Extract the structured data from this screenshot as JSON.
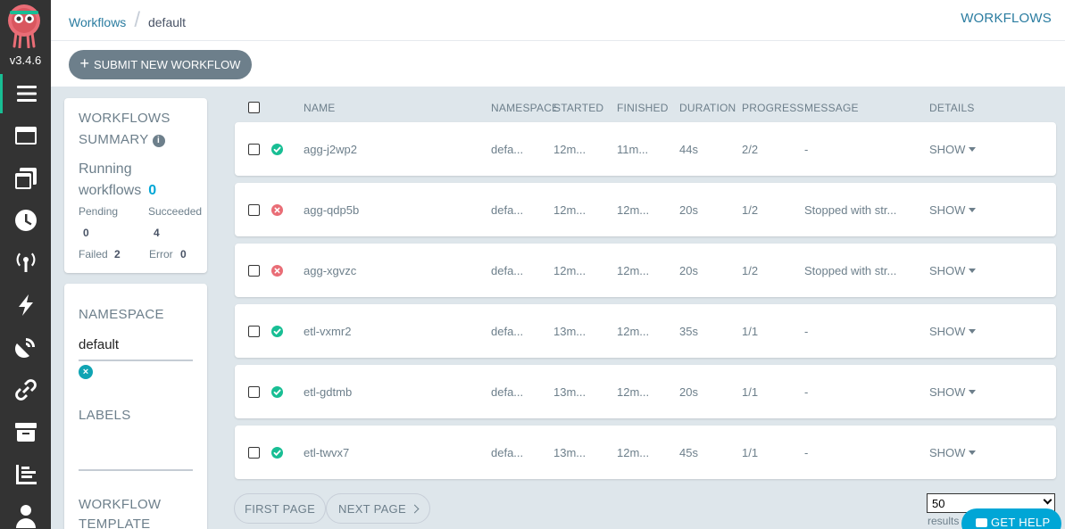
{
  "app": {
    "version": "v3.4.6"
  },
  "breadcrumb": {
    "root": "Workflows",
    "current": "default"
  },
  "page_title": "WORKFLOWS",
  "actions": {
    "submit_label": "SUBMIT NEW WORKFLOW"
  },
  "summary": {
    "title_line1": "WORKFLOWS",
    "title_line2": "SUMMARY",
    "running_line1": "Running",
    "running_line2": "workflows",
    "running_count": "0",
    "pending_label": "Pending",
    "pending_count": "0",
    "succeeded_label": "Succeeded",
    "succeeded_count": "4",
    "failed_label": "Failed",
    "failed_count": "2",
    "error_label": "Error",
    "error_count": "0"
  },
  "filters": {
    "namespace_label": "NAMESPACE",
    "namespace_value": "default",
    "labels_label": "LABELS",
    "workflow_template_label_line1": "WORKFLOW",
    "workflow_template_label_line2": "TEMPLATE"
  },
  "table": {
    "headers": {
      "name": "NAME",
      "namespace": "NAMESPACE",
      "started": "STARTED",
      "finished": "FINISHED",
      "duration": "DURATION",
      "progress": "PROGRESS",
      "message": "MESSAGE",
      "details": "DETAILS"
    },
    "rows": [
      {
        "status": "succeeded",
        "name": "agg-j2wp2",
        "namespace": "defa...",
        "started": "12m...",
        "finished": "11m...",
        "duration": "44s",
        "progress": "2/2",
        "message": "-",
        "details": "SHOW"
      },
      {
        "status": "failed",
        "name": "agg-qdp5b",
        "namespace": "defa...",
        "started": "12m...",
        "finished": "12m...",
        "duration": "20s",
        "progress": "1/2",
        "message": "Stopped with str...",
        "details": "SHOW"
      },
      {
        "status": "failed",
        "name": "agg-xgvzc",
        "namespace": "defa...",
        "started": "12m...",
        "finished": "12m...",
        "duration": "20s",
        "progress": "1/2",
        "message": "Stopped with str...",
        "details": "SHOW"
      },
      {
        "status": "succeeded",
        "name": "etl-vxmr2",
        "namespace": "defa...",
        "started": "13m...",
        "finished": "12m...",
        "duration": "35s",
        "progress": "1/1",
        "message": "-",
        "details": "SHOW"
      },
      {
        "status": "succeeded",
        "name": "etl-gdtmb",
        "namespace": "defa...",
        "started": "13m...",
        "finished": "12m...",
        "duration": "20s",
        "progress": "1/1",
        "message": "-",
        "details": "SHOW"
      },
      {
        "status": "succeeded",
        "name": "etl-twvx7",
        "namespace": "defa...",
        "started": "13m...",
        "finished": "12m...",
        "duration": "45s",
        "progress": "1/1",
        "message": "-",
        "details": "SHOW"
      }
    ]
  },
  "pagination": {
    "first_label": "FIRST PAGE",
    "next_label": "NEXT PAGE",
    "page_size": "50",
    "results_label": "results"
  },
  "help": {
    "label": "GET HELP"
  },
  "colors": {
    "success": "#18be94",
    "failure": "#e96d76",
    "accent": "#00a6d6",
    "link": "#2a7ca0",
    "sidebar": "#333333"
  }
}
